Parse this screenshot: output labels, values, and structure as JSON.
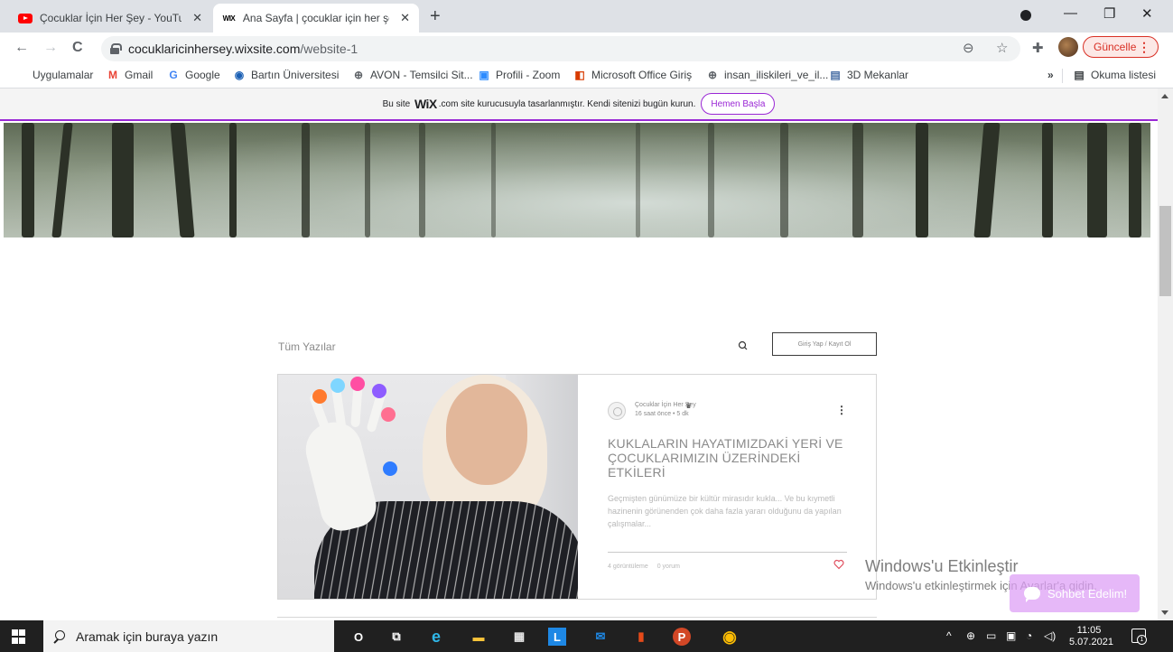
{
  "browser": {
    "tabs": [
      {
        "title": "Çocuklar İçin Her Şey - YouTube",
        "icon": "youtube-icon",
        "close": "✕"
      },
      {
        "title": "Ana Sayfa | çocuklar için her şey",
        "icon": "wix-icon",
        "favicon_text": "WIX",
        "close": "✕"
      }
    ],
    "new_tab_glyph": "+",
    "window_controls": {
      "minimize": "—",
      "restore": "❐",
      "close": "✕"
    },
    "url": {
      "host": "cocuklaricinhersey.wixsite.com",
      "path": "/website-1"
    },
    "nav": {
      "back": "←",
      "forward": "→",
      "reload": "C"
    },
    "toolbar_icons": {
      "zoom": "⊖",
      "star": "☆",
      "extensions": "✚"
    },
    "update_button": "Güncelle",
    "menu_glyph": "⋮"
  },
  "bookmarks": {
    "items": [
      {
        "label": "Uygulamalar",
        "icon": "apps-grid-icon"
      },
      {
        "label": "Gmail",
        "icon": "gmail-icon",
        "glyph": "M",
        "color": "#ea4335"
      },
      {
        "label": "Google",
        "icon": "google-icon",
        "glyph": "G",
        "color": "#4285f4"
      },
      {
        "label": "Bartın Üniversitesi",
        "icon": "university-icon",
        "glyph": "◉",
        "color": "#1a5fb4"
      },
      {
        "label": "AVON - Temsilci Sit...",
        "icon": "globe-icon",
        "glyph": "⊕",
        "color": "#5f6368"
      },
      {
        "label": "Profili - Zoom",
        "icon": "zoom-icon",
        "glyph": "▣",
        "color": "#2d8cff"
      },
      {
        "label": "Microsoft Office Giriş",
        "icon": "office-icon",
        "glyph": "◧",
        "color": "#d83b01"
      },
      {
        "label": "insan_iliskileri_ve_il...",
        "icon": "globe-icon",
        "glyph": "⊕",
        "color": "#5f6368"
      },
      {
        "label": "3D Mekanlar",
        "icon": "image-icon",
        "glyph": "▤",
        "color": "#4a6fa5"
      }
    ],
    "overflow": "»",
    "reading_list": {
      "label": "Okuma listesi",
      "glyph": "▤"
    }
  },
  "wix_banner": {
    "prefix": "Bu site",
    "logo": "WiX",
    "suffix": ".com site kurucusuyla tasarlanmıştır. Kendi sitenizi bugün kurun.",
    "button": "Hemen Başla",
    "accent": "#9a27d5"
  },
  "blog_nav": {
    "all_posts": "Tüm Yazılar",
    "login": "Giriş Yap / Kayıt Ol"
  },
  "post": {
    "author": "Çocuklar İçin Her Şey",
    "meta": "16 saat önce • 5 dk",
    "more_glyph": "⋮",
    "title": "KUKLALARIN HAYATIMIZDAKİ YERİ VE ÇOCUKLARIMIZIN ÜZERİNDEKİ ETKİLERİ",
    "excerpt": "Geçmişten günümüze bir kültür mirasıdır kukla... Ve bu kıymetli hazinenin görünenden çok daha fazla yararı olduğunu da yapılan çalışmalar...",
    "views": "4 görüntüleme",
    "comments": "0 yorum",
    "like_color": "#e04f5f"
  },
  "activation": {
    "heading": "Windows'u Etkinleştir",
    "subtext": "Windows'u etkinleştirmek için Ayarlar'a gidin."
  },
  "chat": {
    "label": "Sohbet Edelim!"
  },
  "taskbar": {
    "search_placeholder": "Aramak için buraya yazın",
    "apps": [
      {
        "name": "cortana-icon",
        "glyph": "O",
        "color": "#ffffff"
      },
      {
        "name": "task-view-icon",
        "glyph": "⧉",
        "color": "#ffffff"
      },
      {
        "name": "edge-icon",
        "glyph": "e",
        "color": "#2fb7e8"
      },
      {
        "name": "file-explorer-icon",
        "glyph": "▬",
        "color": "#f8c43a"
      },
      {
        "name": "store-icon",
        "glyph": "▦",
        "color": "#e8e8e8"
      },
      {
        "name": "lingo-icon",
        "glyph": "L",
        "color": "#1e88e5"
      },
      {
        "name": "mail-icon",
        "glyph": "✉",
        "color": "#1e88e5"
      },
      {
        "name": "office-icon",
        "glyph": "▮",
        "color": "#e64a19"
      },
      {
        "name": "powerpoint-icon",
        "glyph": "P",
        "color": "#d24726"
      },
      {
        "name": "chrome-icon",
        "glyph": "◉",
        "color": "#fbbc04"
      }
    ],
    "tray": {
      "chevron": "^",
      "time": "11:05",
      "date": "5.07.2021",
      "notifications": "1"
    }
  }
}
